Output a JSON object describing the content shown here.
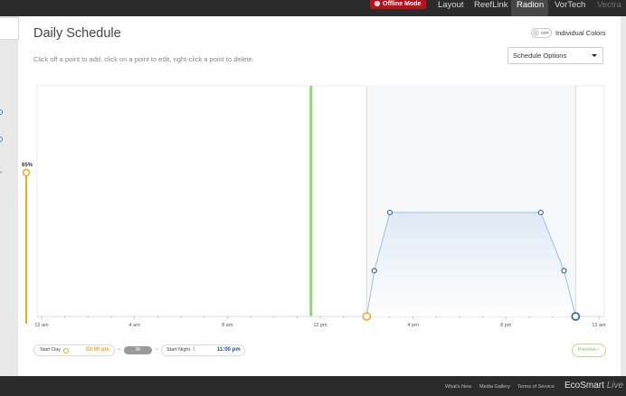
{
  "nav": {
    "offline_label": "Offline Mode",
    "tabs": [
      {
        "label": "Layout"
      },
      {
        "label": "ReefLink"
      },
      {
        "label": "Radion"
      },
      {
        "label": "VorTech"
      },
      {
        "label": "Vectra"
      }
    ],
    "active_tab": "Radion"
  },
  "page": {
    "title": "Daily Schedule",
    "hint": "Click off a point to add, click on a point to edit, right-click a point to delete.",
    "toggle_state": "OFF",
    "individual_colors_label": "Individual Colors",
    "schedule_options_label": "Schedule Options"
  },
  "slider": {
    "value_label": "65%"
  },
  "colors": {
    "accent_orange": "#f5a623",
    "series_blue": "#1f5f9e",
    "current_time_green": "#8fd67a",
    "offline_red": "#b5121b"
  },
  "chart_data": {
    "type": "area",
    "x_tick_labels": [
      "12 am",
      "4 am",
      "8 am",
      "12 pm",
      "4 pm",
      "8 pm",
      "12 am"
    ],
    "x_unit": "hours since midnight",
    "xlim": [
      0,
      24
    ],
    "ylim": [
      0,
      100
    ],
    "series": [
      {
        "points": [
          {
            "x": 14.0,
            "y": 0
          },
          {
            "x": 14.33,
            "y": 22
          },
          {
            "x": 15.0,
            "y": 50
          },
          {
            "x": 21.5,
            "y": 50
          },
          {
            "x": 22.5,
            "y": 22
          },
          {
            "x": 23.0,
            "y": 0
          }
        ]
      }
    ],
    "current_time_hours": 11.6,
    "day_start_hours": 14.0,
    "day_end_hours": 23.0
  },
  "controls": {
    "start_day_label": "Start Day",
    "start_day_value": "02:00 pm",
    "duration_label": "9h",
    "start_night_label": "Start Night",
    "start_night_value": "11:00 pm",
    "preview_label": "Preview"
  },
  "footer": {
    "links": [
      "What's New",
      "Media Gallery",
      "Terms of Service"
    ],
    "brand_main": "EcoSmart",
    "brand_live": "Live"
  }
}
